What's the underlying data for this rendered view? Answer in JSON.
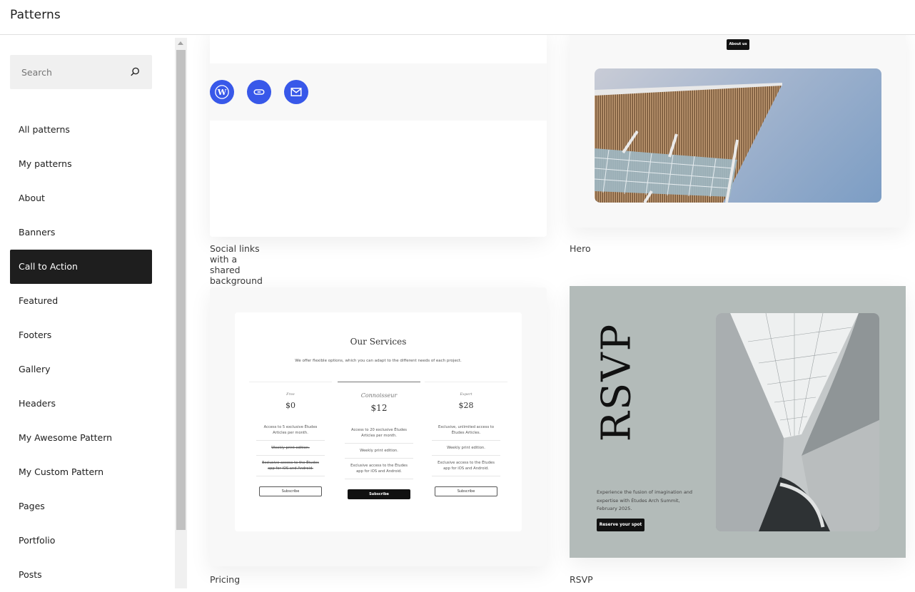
{
  "header": {
    "title": "Patterns"
  },
  "search": {
    "placeholder": "Search",
    "icon": "search-icon"
  },
  "sidebar": {
    "items": [
      {
        "label": "All patterns",
        "active": false
      },
      {
        "label": "My patterns",
        "active": false
      },
      {
        "label": "About",
        "active": false
      },
      {
        "label": "Banners",
        "active": false
      },
      {
        "label": "Call to Action",
        "active": true
      },
      {
        "label": "Featured",
        "active": false
      },
      {
        "label": "Footers",
        "active": false
      },
      {
        "label": "Gallery",
        "active": false
      },
      {
        "label": "Headers",
        "active": false
      },
      {
        "label": "My Awesome Pattern",
        "active": false
      },
      {
        "label": "My Custom Pattern",
        "active": false
      },
      {
        "label": "Pages",
        "active": false
      },
      {
        "label": "Portfolio",
        "active": false
      },
      {
        "label": "Posts",
        "active": false
      }
    ]
  },
  "colors": {
    "accent": "#3858e9",
    "active_nav": "#1e1e1e",
    "rsvp_bg": "#b3bbb9"
  },
  "patterns": {
    "social": {
      "label": "Social links with a shared background color",
      "icons": [
        "wordpress-icon",
        "link-icon",
        "mail-icon"
      ]
    },
    "hero": {
      "label": "Hero",
      "button": "About us"
    },
    "pricing": {
      "label": "Pricing",
      "title": "Our Services",
      "subtitle": "We offer flexible options, which you can adapt to the different needs of each project.",
      "tiers": [
        {
          "name": "Free",
          "price": "$0",
          "features": [
            "Access to 5 exclusive Études Articles per month.",
            "Weekly print edition.",
            "Exclusive access to the Études app for iOS and Android."
          ],
          "button": "Subscribe"
        },
        {
          "name": "Connoisseur",
          "price": "$12",
          "features": [
            "Access to 20 exclusive Études Articles per month.",
            "Weekly print edition.",
            "Exclusive access to the Études app for iOS and Android."
          ],
          "button": "Subscribe"
        },
        {
          "name": "Expert",
          "price": "$28",
          "features": [
            "Exclusive, unlimited access to Études Articles.",
            "Weekly print edition.",
            "Exclusive access to the Études app for iOS and Android."
          ],
          "button": "Subscribe"
        }
      ]
    },
    "rsvp": {
      "label": "RSVP",
      "title": "RSVP",
      "text": "Experience the fusion of imagination and expertise with Études Arch Summit, February 2025.",
      "button": "Reserve your spot"
    }
  }
}
